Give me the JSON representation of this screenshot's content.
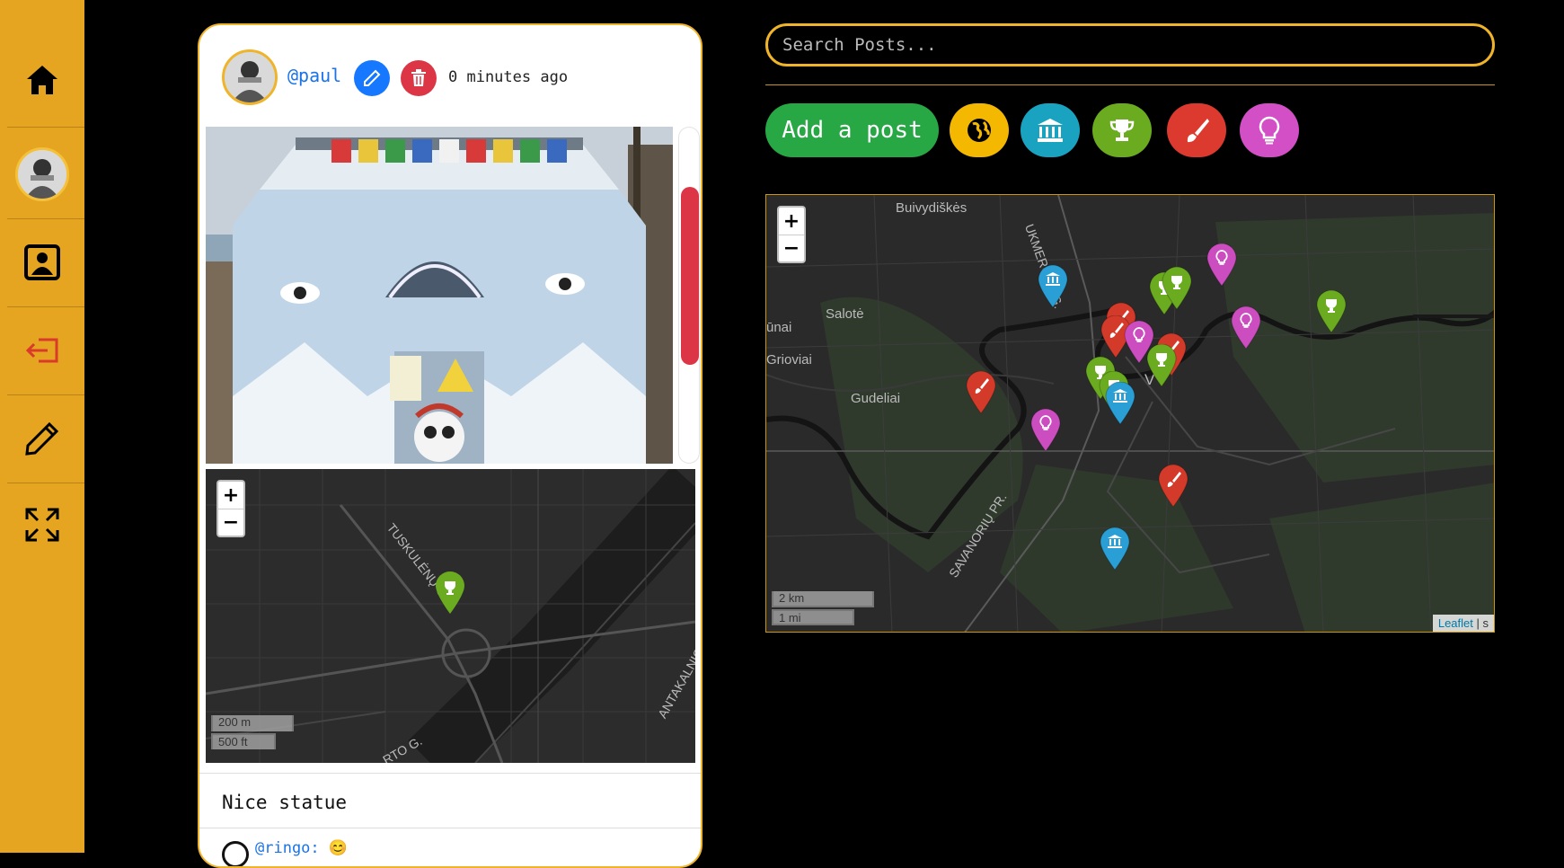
{
  "sidebar": {
    "items": [
      {
        "name": "home-icon"
      },
      {
        "name": "profile-avatar"
      },
      {
        "name": "contact-icon"
      },
      {
        "name": "logout-icon"
      },
      {
        "name": "pencil-icon"
      },
      {
        "name": "expand-icon"
      }
    ]
  },
  "post": {
    "username": "@paul",
    "timestamp": "0 minutes ago",
    "caption": "Nice statue",
    "comment": "@ringo: 😊",
    "mini_map": {
      "zoom_in": "+",
      "zoom_out": "−",
      "scale_metric": "200 m",
      "scale_imperial": "500 ft",
      "street_labels": [
        "TUSKULĖNŲ G.",
        "ANTAKALNIO",
        "RTO G."
      ]
    }
  },
  "search": {
    "placeholder": "Search Posts..."
  },
  "actions": {
    "add_post_label": "Add a post",
    "categories": [
      {
        "name": "all-categories-button",
        "icon": "globe-icon",
        "color": "#f5b800"
      },
      {
        "name": "museum-category-button",
        "icon": "museum-icon",
        "color": "#1aa3c0"
      },
      {
        "name": "trophy-category-button",
        "icon": "trophy-icon",
        "color": "#6aab20"
      },
      {
        "name": "art-category-button",
        "icon": "paintbrush-icon",
        "color": "#dc3a2f"
      },
      {
        "name": "idea-category-button",
        "icon": "lightbulb-icon",
        "color": "#d24fc6"
      }
    ]
  },
  "map": {
    "zoom_in": "+",
    "zoom_out": "−",
    "labels": [
      "Buivydiškės",
      "Salotė",
      "ūnai",
      "Grioviai",
      "Gudeliai",
      "UKMERGĖS G.",
      "SAVANORIŲ PR.",
      "V"
    ],
    "scale_metric": "2 km",
    "scale_imperial": "1 mi",
    "attribution_link": "Leaflet",
    "attribution_rest": " | s"
  },
  "colors": {
    "sidebar": "#e5a521",
    "accent": "#f0b42a",
    "trophy": "#6aab20",
    "museum": "#2a9fd6",
    "art": "#d43a2a",
    "idea": "#cc4dbf"
  }
}
